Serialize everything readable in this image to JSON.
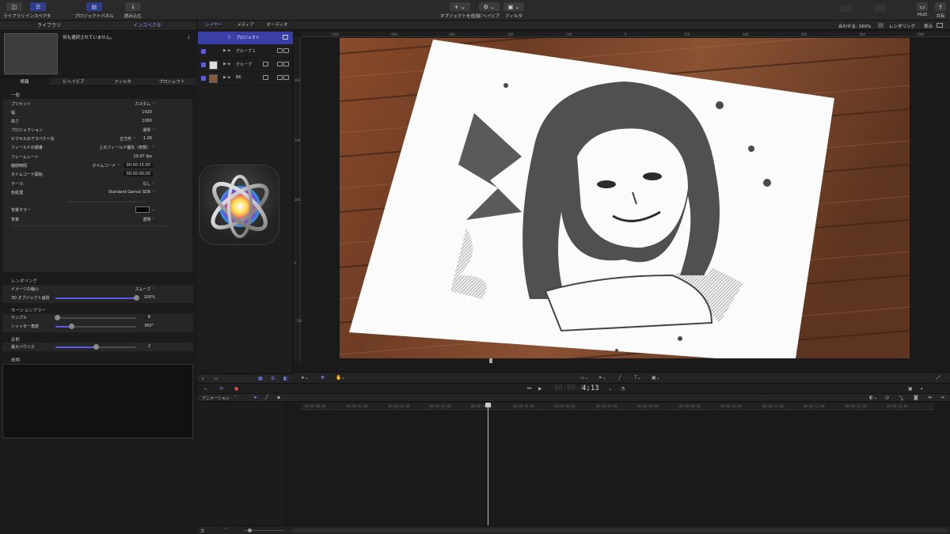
{
  "toolbar": {
    "library": "ライブラリ",
    "inspector": "インスペクタ",
    "project_panel": "プロジェクトパネル",
    "import": "読み込む",
    "add_object": "オブジェクトを追加",
    "behaviors": "ビヘイビア",
    "filters": "フィルタ",
    "hud": "HUD",
    "share": "共有"
  },
  "left_tabs": {
    "library": "ライブラリ",
    "inspector": "インスペクタ"
  },
  "preview": {
    "message": "何も選択されていません。"
  },
  "inspector_tabs": [
    "情報",
    "ビヘイビア",
    "フィルタ",
    "プロジェクト"
  ],
  "general": {
    "header": "一般",
    "rows": [
      {
        "label": "プリセット",
        "value": "カスタム"
      },
      {
        "label": "幅",
        "value": "1920"
      },
      {
        "label": "高さ",
        "value": "1080"
      },
      {
        "label": "プロジェクション",
        "value": "通常"
      },
      {
        "label": "ピクセルのアスペクト比",
        "value": "正方形",
        "value2": "1.00"
      },
      {
        "label": "フィールドの順番",
        "value": "上のフィールド優先（奇数）"
      },
      {
        "label": "フレームレート",
        "value": "29.97 fps"
      },
      {
        "label": "継続時間",
        "value": "タイムコード",
        "value2": "00:00:15;00"
      },
      {
        "label": "タイムコード開始",
        "value2": "00:00:00;00"
      },
      {
        "label": "テーマ:",
        "value": "なし"
      },
      {
        "label": "色処理",
        "value": "Standard Gamut SDR"
      }
    ],
    "bg_color_label": "背景カラー",
    "background_label": "背景",
    "background_value": "透明"
  },
  "rendering": {
    "header": "レンダリング",
    "image_scaling_label": "イメージの縮小",
    "image_scaling_value": "スムーズ",
    "object_quality_label": "3D オブジェクト画質",
    "object_quality_value": "100%",
    "object_quality_level": 1.0
  },
  "motion_blur": {
    "header": "モーションブラー",
    "samples_label": "サンプル",
    "samples_value": "8",
    "samples_level": 0.02,
    "shutter_label": "シャッター角度",
    "shutter_value": "360°",
    "shutter_level": 0.2
  },
  "reflection": {
    "header": "反射",
    "max_bounces_label": "最大バウンス",
    "max_bounces_value": "2",
    "max_bounces_level": 0.5
  },
  "description": {
    "header": "説明"
  },
  "layers_panel": {
    "tabs": [
      "レイヤー",
      "メディア",
      "オーディオ"
    ],
    "project": "プロジェクト",
    "items": [
      "グループ 1",
      "グループ",
      "BK"
    ]
  },
  "canvas": {
    "zoom": "合わせる: 160%",
    "render": "レンダリング",
    "view": "表示",
    "ruler_h": [
      "-1000",
      "-800",
      "-600",
      "-400",
      "-200",
      "0",
      "200",
      "400",
      "600",
      "800",
      "1000"
    ],
    "ruler_v": [
      "600",
      "400",
      "200",
      "0",
      "-200",
      "-400",
      "-600"
    ]
  },
  "transport": {
    "timecode_dim": "00:00:0",
    "timecode": "4;13"
  },
  "timeline": {
    "animation_menu": "アニメーション",
    "timecodes": [
      "00:00:00;00",
      "00:00:01;00",
      "00:00:02;00",
      "00:00:03;00",
      "00:00:04;00",
      "00:00:05;00",
      "00:00:06;00",
      "00:00:07;00",
      "00:00:08;00",
      "00:00:09;00",
      "00:00:10;00",
      "00:00:11;00",
      "00:00:12;00",
      "00:00:13;00",
      "00:00:14;00"
    ]
  },
  "status": {
    "size": "大"
  },
  "colors": {
    "accent": "#5c5ce0",
    "selected": "#3a3fa8",
    "panel": "#262626"
  }
}
